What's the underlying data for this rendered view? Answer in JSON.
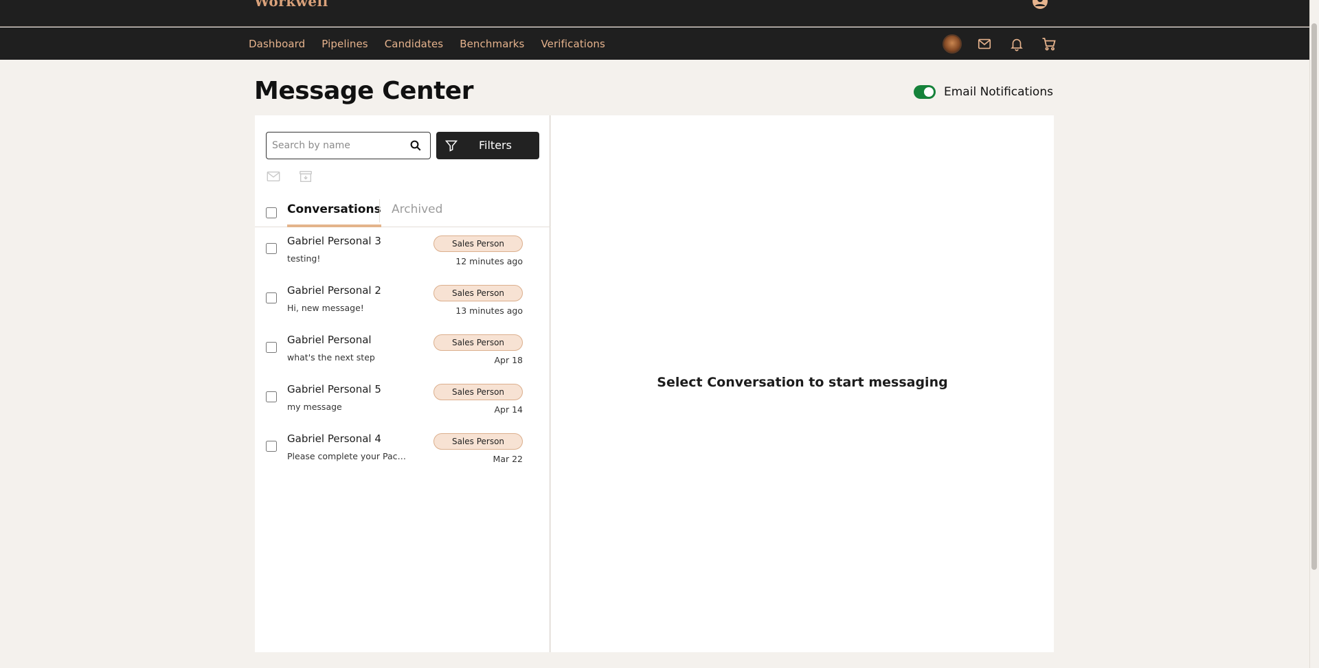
{
  "app": {
    "brand": "Workwell"
  },
  "nav": {
    "links": [
      "Dashboard",
      "Pipelines",
      "Candidates",
      "Benchmarks",
      "Verifications"
    ]
  },
  "page": {
    "title": "Message Center",
    "email_notifications_label": "Email Notifications",
    "email_notifications_on": true
  },
  "search": {
    "placeholder": "Search by name",
    "value": ""
  },
  "filters": {
    "label": "Filters"
  },
  "tabs": [
    "Conversations",
    "Archived"
  ],
  "conversations": [
    {
      "name": "Gabriel Personal 3",
      "preview": "testing!",
      "badge": "Sales Person",
      "time": "12 minutes ago"
    },
    {
      "name": "Gabriel Personal 2",
      "preview": "Hi, new message!",
      "badge": "Sales Person",
      "time": "13 minutes ago"
    },
    {
      "name": "Gabriel Personal",
      "preview": "what's the next step",
      "badge": "Sales Person",
      "time": "Apr 18"
    },
    {
      "name": "Gabriel Personal 5",
      "preview": "my message",
      "badge": "Sales Person",
      "time": "Apr 14"
    },
    {
      "name": "Gabriel Personal 4",
      "preview": "Please complete your Packfin...",
      "badge": "Sales Person",
      "time": "Mar 22"
    }
  ],
  "empty_state": "Select Conversation to start messaging",
  "colors": {
    "nav_bg": "#1f1f1f",
    "nav_link": "#e6b38d",
    "toggle_on": "#15823a",
    "badge_bg": "#f7e2d3",
    "tab_underline": "#e3b48b",
    "page_bg": "#f4f1ed"
  }
}
